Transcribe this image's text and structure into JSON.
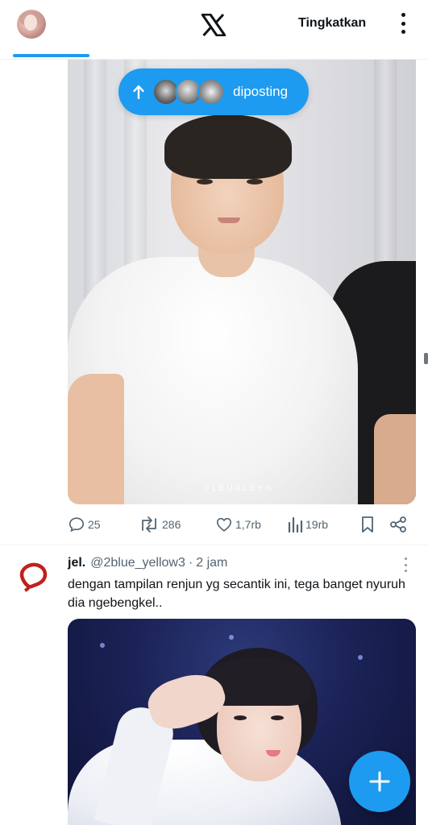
{
  "header": {
    "logo_icon": "x-logo-icon",
    "upgrade_label": "Tingkatkan",
    "more_icon": "more-vertical-icon",
    "active_tab_color": "#1d9bf0"
  },
  "posted_pill": {
    "icon": "arrow-up-icon",
    "label": "diposting",
    "color": "#1d9bf0"
  },
  "post1": {
    "media_watermark": "FLEURLEYN",
    "actions": {
      "reply_count": "25",
      "repost_count": "286",
      "like_count": "1,7rb",
      "view_count": "19rb"
    }
  },
  "post2": {
    "display_name": "jel.",
    "handle": "@2blue_yellow3",
    "separator": "·",
    "time": "2 jam",
    "text": "dengan tampilan renjun yg secantik ini, tega banget nyuruh dia ngebengkel.."
  },
  "fab": {
    "icon": "plus-icon",
    "color": "#1d9bf0"
  }
}
